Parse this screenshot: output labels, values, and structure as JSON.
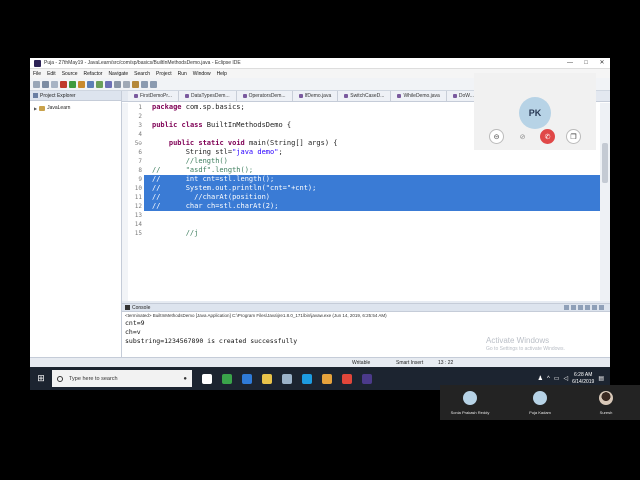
{
  "window": {
    "title": "Puja - 27thMay19 - JavaLearn/src/com/sp/basics/BuiltInMethodsDemo.java - Eclipse IDE",
    "controls": [
      "—",
      "□",
      "✕"
    ]
  },
  "menu": [
    "File",
    "Edit",
    "Source",
    "Refactor",
    "Navigate",
    "Search",
    "Project",
    "Run",
    "Window",
    "Help"
  ],
  "explorer": {
    "tab_label": "Project Explorer",
    "items": [
      {
        "label": "JavaLearn"
      }
    ]
  },
  "editor": {
    "tabs": [
      "FirstDemoPr...",
      "DataTypesDem...",
      "OperatorsDem...",
      "IfDemo.java",
      "SwitchCaseD...",
      "WhileDemo.java",
      "DoW..."
    ],
    "lines": [
      {
        "n": "1",
        "segs": [
          {
            "t": "package",
            "c": "kw"
          },
          {
            "t": " com.sp.basics;",
            "c": ""
          }
        ]
      },
      {
        "n": "2",
        "segs": []
      },
      {
        "n": "3",
        "segs": [
          {
            "t": "public",
            "c": "kw"
          },
          {
            "t": " ",
            "c": ""
          },
          {
            "t": "class",
            "c": "kw"
          },
          {
            "t": " BuiltInMethodsDemo {",
            "c": ""
          }
        ]
      },
      {
        "n": "4",
        "segs": []
      },
      {
        "n": "5⊖",
        "segs": [
          {
            "t": "    ",
            "c": ""
          },
          {
            "t": "public",
            "c": "kw"
          },
          {
            "t": " ",
            "c": ""
          },
          {
            "t": "static",
            "c": "kw"
          },
          {
            "t": " ",
            "c": ""
          },
          {
            "t": "void",
            "c": "kw"
          },
          {
            "t": " main(String[] args) {",
            "c": ""
          }
        ]
      },
      {
        "n": "6",
        "segs": [
          {
            "t": "        String stl=",
            "c": ""
          },
          {
            "t": "\"java demo\"",
            "c": "str"
          },
          {
            "t": ";",
            "c": ""
          }
        ]
      },
      {
        "n": "7",
        "segs": [
          {
            "t": "        //length()",
            "c": "cmt"
          }
        ]
      },
      {
        "n": "8",
        "segs": [
          {
            "t": "//      \"asdf\".length();",
            "c": "cmt"
          }
        ]
      },
      {
        "n": "9",
        "sel": true,
        "segs": [
          {
            "t": "//      int cnt=stl.length();",
            "c": "cmt"
          }
        ]
      },
      {
        "n": "10",
        "sel": true,
        "segs": [
          {
            "t": "//      System.out.println(\"cnt=\"+cnt);",
            "c": "cmt"
          }
        ]
      },
      {
        "n": "11",
        "sel": true,
        "segs": [
          {
            "t": "//        //charAt(position)",
            "c": "cmt"
          }
        ]
      },
      {
        "n": "12",
        "sel": true,
        "segs": [
          {
            "t": "//      char ch=stl.charAt(2);",
            "c": "cmt"
          }
        ]
      },
      {
        "n": "13",
        "sel": true,
        "segs": [
          {
            "t": "//      System.out.println(\"ch=\"+ch);",
            "c": "cmt"
          }
        ]
      },
      {
        "n": "14",
        "segs": []
      },
      {
        "n": "15",
        "segs": [
          {
            "t": "        //j",
            "c": "cmt"
          }
        ]
      }
    ]
  },
  "console": {
    "tab_label": "Console",
    "status": "<terminated> BuiltInMethodsDemo [Java Application] C:\\Program Files\\Java\\jre1.8.0_171\\bin\\javaw.exe (Jun 14, 2019, 6:25:54 AM)",
    "output": [
      "cnt=9",
      "ch=v",
      "substring=1234567890 is created successfully"
    ]
  },
  "status_bar": {
    "mode": "Writable",
    "insert": "Smart Insert",
    "position": "13 : 22"
  },
  "activation": {
    "title": "Activate Windows",
    "subtitle": "Go to Settings to activate Windows."
  },
  "taskbar": {
    "search_placeholder": "Type here to search",
    "icons": [
      {
        "name": "task-view",
        "color": "#ffffff"
      },
      {
        "name": "file-manager",
        "color": "#3aa34a"
      },
      {
        "name": "edge",
        "color": "#2f7ad6"
      },
      {
        "name": "explorer",
        "color": "#e8c24a"
      },
      {
        "name": "store",
        "color": "#9bb2c8"
      },
      {
        "name": "skype",
        "color": "#1d9be0"
      },
      {
        "name": "cloud",
        "color": "#e6a23c"
      },
      {
        "name": "chrome",
        "color": "#e0463a"
      },
      {
        "name": "eclipse",
        "color": "#4b3a8a"
      }
    ],
    "time": "6:28 AM",
    "date": "6/14/2019"
  },
  "call": {
    "initials": "PK",
    "participants": [
      {
        "name": "Sonia Prakash Reddy"
      },
      {
        "name": "Puja Kadam"
      },
      {
        "name": "Suresh"
      }
    ]
  }
}
